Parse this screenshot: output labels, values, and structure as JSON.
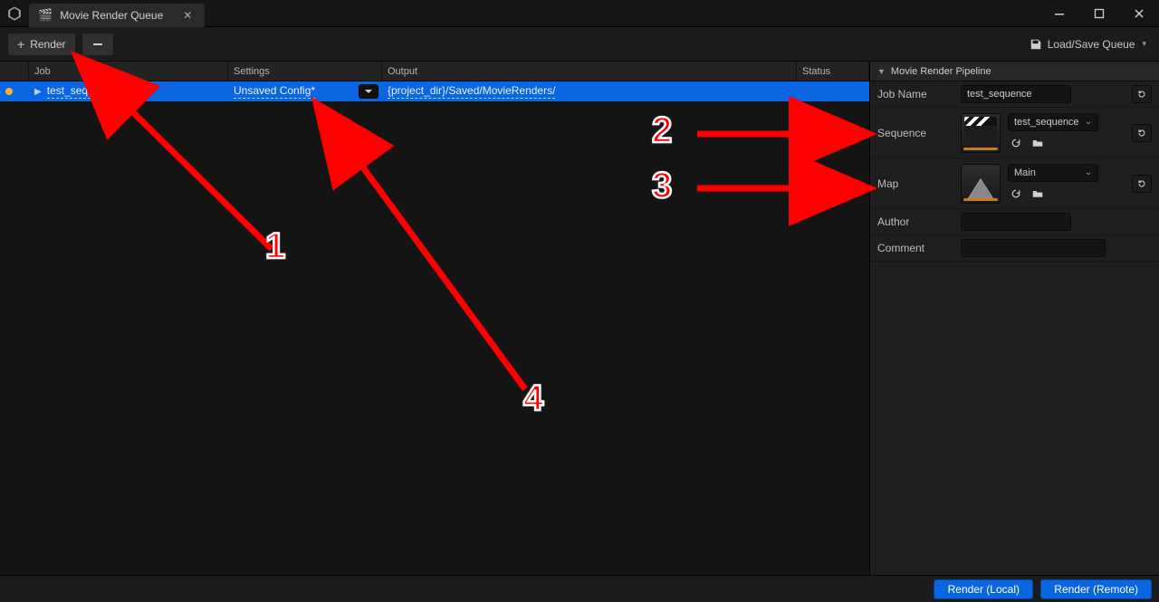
{
  "window": {
    "tab_title": "Movie Render Queue"
  },
  "toolbar": {
    "render_label": "Render",
    "load_save_label": "Load/Save Queue"
  },
  "queue": {
    "headers": {
      "job": "Job",
      "settings": "Settings",
      "output": "Output",
      "status": "Status"
    },
    "row": {
      "job_name": "test_sequence",
      "settings": "Unsaved Config*",
      "output": "{project_dir}/Saved/MovieRenders/",
      "status": ""
    }
  },
  "details": {
    "section_title": "Movie Render Pipeline",
    "job_name_label": "Job Name",
    "job_name_value": "test_sequence",
    "sequence_label": "Sequence",
    "sequence_value": "test_sequence",
    "map_label": "Map",
    "map_value": "Main",
    "author_label": "Author",
    "author_value": "",
    "comment_label": "Comment",
    "comment_value": ""
  },
  "footer": {
    "render_local": "Render (Local)",
    "render_remote": "Render (Remote)"
  },
  "annotations": {
    "n1": "1",
    "n2": "2",
    "n3": "3",
    "n4": "4"
  }
}
